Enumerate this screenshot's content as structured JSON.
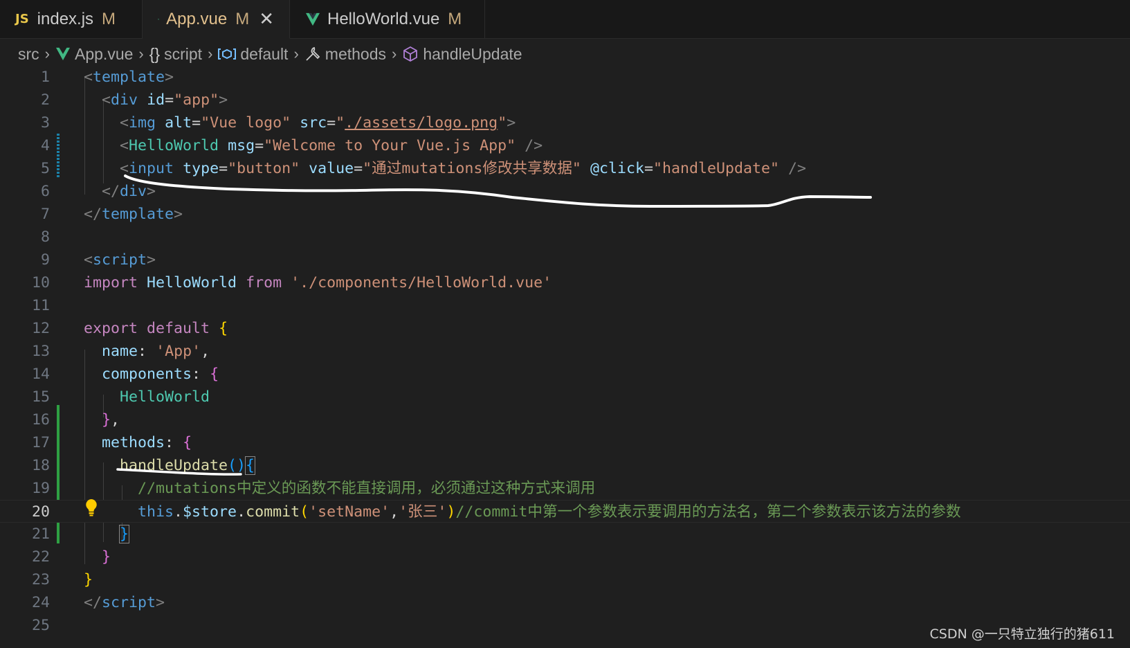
{
  "tabs": [
    {
      "label": "index.js",
      "icon": "js-icon",
      "badge": "JS",
      "status": "M",
      "active": false
    },
    {
      "label": "App.vue",
      "icon": "vue-icon",
      "status": "M",
      "active": true,
      "close": "✕"
    },
    {
      "label": "HelloWorld.vue",
      "icon": "vue-icon",
      "status": "M",
      "active": false
    }
  ],
  "breadcrumb": {
    "items": [
      "src",
      "App.vue",
      "script",
      "default",
      "methods",
      "handleUpdate"
    ],
    "icons": [
      "",
      "vue-icon",
      "braces-icon",
      "module-icon",
      "wrench-icon",
      "cube-icon"
    ],
    "braces_glyph": "{}"
  },
  "editor": {
    "current_line": 20,
    "line_numbers": [
      "1",
      "2",
      "3",
      "4",
      "5",
      "6",
      "7",
      "8",
      "9",
      "10",
      "11",
      "12",
      "13",
      "14",
      "15",
      "16",
      "17",
      "18",
      "19",
      "20",
      "21",
      "22",
      "23",
      "24",
      "25"
    ],
    "code": {
      "l1": [
        "<",
        "template",
        ">"
      ],
      "l2": [
        "  ",
        "<",
        "div",
        " ",
        "id",
        "=",
        "\"app\"",
        ">"
      ],
      "l3": [
        "    ",
        "<",
        "img",
        " ",
        "alt",
        "=",
        "\"Vue logo\"",
        " ",
        "src",
        "=",
        "\"",
        "./assets/logo.png",
        "\"",
        ">"
      ],
      "l4": [
        "    ",
        "<",
        "HelloWorld",
        " ",
        "msg",
        "=",
        "\"Welcome to Your Vue.js App\"",
        " ",
        "/>"
      ],
      "l5": [
        "    ",
        "<",
        "input",
        " ",
        "type",
        "=",
        "\"button\"",
        " ",
        "value",
        "=",
        "\"通过mutations修改共享数据\"",
        " ",
        "@click",
        "=",
        "\"handleUpdate\"",
        " ",
        "/>"
      ],
      "l6": [
        "  ",
        "</",
        "div",
        ">"
      ],
      "l7": [
        "</",
        "template",
        ">"
      ],
      "l9": [
        "<",
        "script",
        ">"
      ],
      "l10": [
        "import",
        " ",
        "HelloWorld",
        " ",
        "from",
        " ",
        "'./components/HelloWorld.vue'"
      ],
      "l12": [
        "export",
        " ",
        "default",
        " ",
        "{"
      ],
      "l13": [
        "  ",
        "name",
        ":",
        " ",
        "'App'",
        ","
      ],
      "l14": [
        "  ",
        "components",
        ":",
        " ",
        "{"
      ],
      "l15": [
        "    ",
        "HelloWorld"
      ],
      "l16": [
        "  ",
        "}",
        ","
      ],
      "l17": [
        "  ",
        "methods",
        ":",
        " ",
        "{"
      ],
      "l18": [
        "    ",
        "handleUpdate",
        "()",
        "{"
      ],
      "l19": [
        "      ",
        "//mutations中定义的函数不能直接调用，必须通过这种方式来调用"
      ],
      "l20": [
        "      ",
        "this",
        ".",
        "$store",
        ".",
        "commit",
        "(",
        "'setName'",
        ",",
        "'张三'",
        ")",
        "//commit中第一个参数表示要调用的方法名，第二个参数表示该方法的参数"
      ],
      "l21": [
        "    ",
        "}"
      ],
      "l22": [
        "  ",
        "}"
      ],
      "l23": [
        "}"
      ],
      "l24": [
        "</",
        "script",
        ">"
      ]
    }
  },
  "watermark": "CSDN @一只特立独行的猪611",
  "colors": {
    "background": "#1f1f1f",
    "modified": "#e2c08d",
    "git_added": "#2ea043",
    "git_changed": "#1b81a8",
    "annotation_stroke": "#ffffff"
  }
}
